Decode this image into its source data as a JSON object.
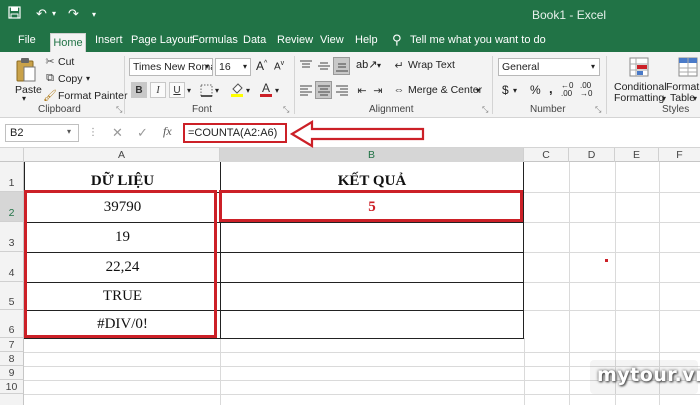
{
  "window": {
    "title": "Book1 - Excel",
    "tell_me": "Tell me what you want to do"
  },
  "tabs": [
    {
      "label": "File"
    },
    {
      "label": "Home"
    },
    {
      "label": "Insert"
    },
    {
      "label": "Page Layout"
    },
    {
      "label": "Formulas"
    },
    {
      "label": "Data"
    },
    {
      "label": "Review"
    },
    {
      "label": "View"
    },
    {
      "label": "Help"
    }
  ],
  "ribbon": {
    "clipboard": {
      "label": "Clipboard",
      "paste": "Paste",
      "cut": "Cut",
      "copy": "Copy",
      "format_painter": "Format Painter"
    },
    "font": {
      "label": "Font",
      "family": "Times New Roman",
      "size": "16",
      "bold": "B",
      "italic": "I",
      "underline": "U"
    },
    "alignment": {
      "label": "Alignment",
      "wrap_text": "Wrap Text",
      "merge_center": "Merge & Center"
    },
    "number": {
      "label": "Number",
      "format": "General"
    },
    "styles": {
      "label": "Styles",
      "conditional_1": "Conditional",
      "conditional_2": "Formatting",
      "format_as_1": "Format a",
      "format_as_2": "Table"
    }
  },
  "formula_bar": {
    "name_box": "B2",
    "fx": "fx",
    "formula": "=COUNTA(A2:A6)"
  },
  "columns": [
    "A",
    "B",
    "C",
    "D",
    "E",
    "F"
  ],
  "rows": [
    "1",
    "2",
    "3",
    "4",
    "5",
    "6",
    "7",
    "8",
    "9",
    "10"
  ],
  "sheet": {
    "header_a": "DỮ LIỆU",
    "header_b": "KẾT QUẢ",
    "data": [
      "39790",
      "19",
      "22,24",
      "TRUE",
      "#DIV/0!"
    ],
    "result": "5"
  },
  "colors": {
    "excel_green": "#217346",
    "highlight_red": "#cc2027"
  },
  "watermark": "mytour.vn"
}
